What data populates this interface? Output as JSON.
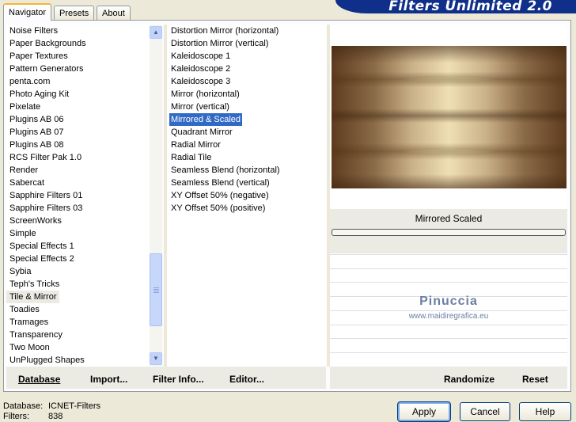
{
  "tabs": [
    {
      "label": "Navigator"
    },
    {
      "label": "Presets"
    },
    {
      "label": "About"
    }
  ],
  "banner_title": "Filters Unlimited 2.0",
  "categories": [
    "Noise Filters",
    "Paper Backgrounds",
    "Paper Textures",
    "Pattern Generators",
    "penta.com",
    "Photo Aging Kit",
    "Pixelate",
    "Plugins AB 06",
    "Plugins AB 07",
    "Plugins AB 08",
    "RCS Filter Pak 1.0",
    "Render",
    "Sabercat",
    "Sapphire Filters 01",
    "Sapphire Filters 03",
    "ScreenWorks",
    "Simple",
    "Special Effects 1",
    "Special Effects 2",
    "Sybia",
    "Teph's Tricks",
    "Tile & Mirror",
    "Toadies",
    "Tramages",
    "Transparency",
    "Two Moon",
    "UnPlugged Shapes"
  ],
  "selected_category": "Tile & Mirror",
  "filters": [
    "Distortion Mirror (horizontal)",
    "Distortion Mirror (vertical)",
    "Kaleidoscope 1",
    "Kaleidoscope 2",
    "Kaleidoscope 3",
    "Mirror (horizontal)",
    "Mirror (vertical)",
    "Mirrored & Scaled",
    "Quadrant Mirror",
    "Radial Mirror",
    "Radial Tile",
    "Seamless Blend (horizontal)",
    "Seamless Blend (vertical)",
    "XY Offset 50% (negative)",
    "XY Offset 50% (positive)"
  ],
  "selected_filter": "Mirrored & Scaled",
  "preview_filter_name": "Mirrored  Scaled",
  "watermark": {
    "name": "Pinuccia",
    "url": "www.maidiregrafica.eu"
  },
  "bottom_bar": {
    "database": "Database",
    "import": "Import...",
    "filter_info": "Filter Info...",
    "editor": "Editor...",
    "randomize": "Randomize",
    "reset": "Reset"
  },
  "status": {
    "database_label": "Database:",
    "database_value": "ICNET-Filters",
    "filters_label": "Filters:",
    "filters_value": "838"
  },
  "buttons": {
    "apply": "Apply",
    "cancel": "Cancel",
    "help": "Help"
  },
  "colors": {
    "selection": "#316ac5",
    "banner": "#0f2f8a",
    "window_bg": "#ece9d8"
  }
}
